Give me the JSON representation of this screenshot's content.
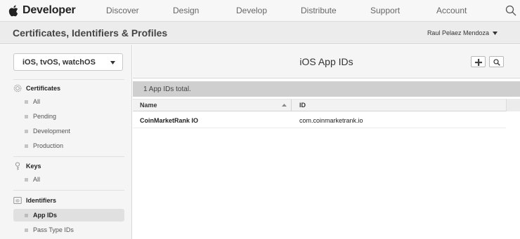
{
  "nav": {
    "brand": "Developer",
    "links": [
      "Discover",
      "Design",
      "Develop",
      "Distribute",
      "Support",
      "Account"
    ]
  },
  "header": {
    "title": "Certificates, Identifiers & Profiles",
    "user": "Raul Pelaez Mendoza"
  },
  "sidebar": {
    "platform": "iOS, tvOS, watchOS",
    "certificates": {
      "title": "Certificates",
      "items": [
        "All",
        "Pending",
        "Development",
        "Production"
      ]
    },
    "keys": {
      "title": "Keys",
      "items": [
        "All"
      ]
    },
    "identifiers": {
      "title": "Identifiers",
      "items": [
        "App IDs",
        "Pass Type IDs"
      ],
      "active": "App IDs"
    }
  },
  "main": {
    "title": "iOS App IDs",
    "count_text": "1  App IDs total.",
    "columns": [
      "Name",
      "ID"
    ],
    "rows": [
      {
        "name": "CoinMarketRank IO",
        "id": "com.coinmarketrank.io"
      }
    ]
  },
  "icons": {
    "brand": "apple-logo-icon",
    "search": "search-icon",
    "add": "plus-icon",
    "caret": "caret-down-icon"
  }
}
